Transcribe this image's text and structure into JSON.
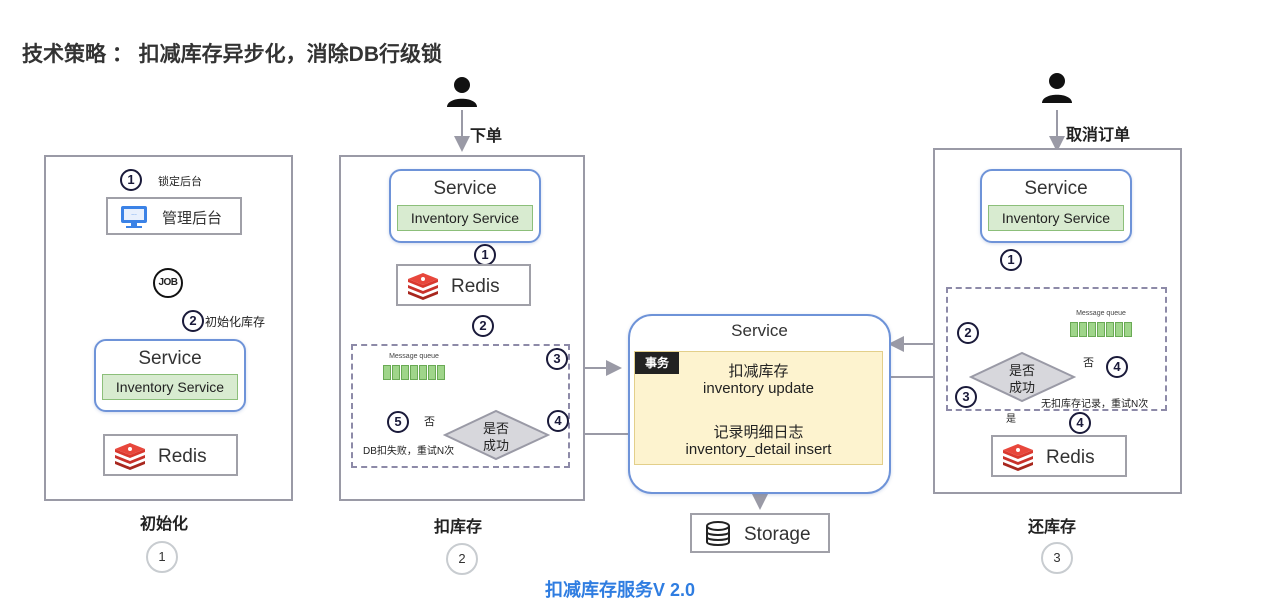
{
  "header": {
    "title": "技术策略 ： 扣减库存异步化，消除DB行级锁"
  },
  "footer": {
    "caption": "扣减库存服务V 2.0"
  },
  "common": {
    "service": "Service",
    "inventory_service": "Inventory Service",
    "redis": "Redis",
    "message_queue": "Message queue",
    "decision": [
      "是否",
      "成功"
    ],
    "no": "否",
    "yes": "是"
  },
  "panel_init": {
    "step1_num": "1",
    "step1_label": "锁定后台",
    "admin_label": "管理后台",
    "job_label": "JOB",
    "step2_num": "2",
    "step2_label": "初始化库存",
    "caption": "初始化",
    "index": "1"
  },
  "panel_deduct": {
    "actor_label": "下单",
    "n1": "1",
    "n2": "2",
    "n3": "3",
    "n4": "4",
    "n5": "5",
    "retry_label": "DB扣失败，重试N次",
    "caption": "扣库存",
    "index": "2"
  },
  "panel_restore": {
    "actor_label": "取消订单",
    "n1": "1",
    "n2": "2",
    "n3": "3",
    "n4a": "4",
    "n4b": "4",
    "retry_label": "无扣库存记录，重试N次",
    "caption": "还库存",
    "index": "3"
  },
  "center": {
    "service_title": "Service",
    "tx_tag": "事务",
    "line1": "扣减库存",
    "line2": "inventory update",
    "line3": "记录明细日志",
    "line4": "inventory_detail insert",
    "storage": "Storage"
  },
  "colors": {
    "service_border": "#6e93d8",
    "inventory_fill": "#d8ebd0",
    "tx_fill": "#fdf3cf",
    "caption_blue": "#2f7de1"
  },
  "icons": [
    "user-icon",
    "redis-icon",
    "monitor-icon",
    "job-icon",
    "database-icon",
    "message-queue-icon"
  ]
}
